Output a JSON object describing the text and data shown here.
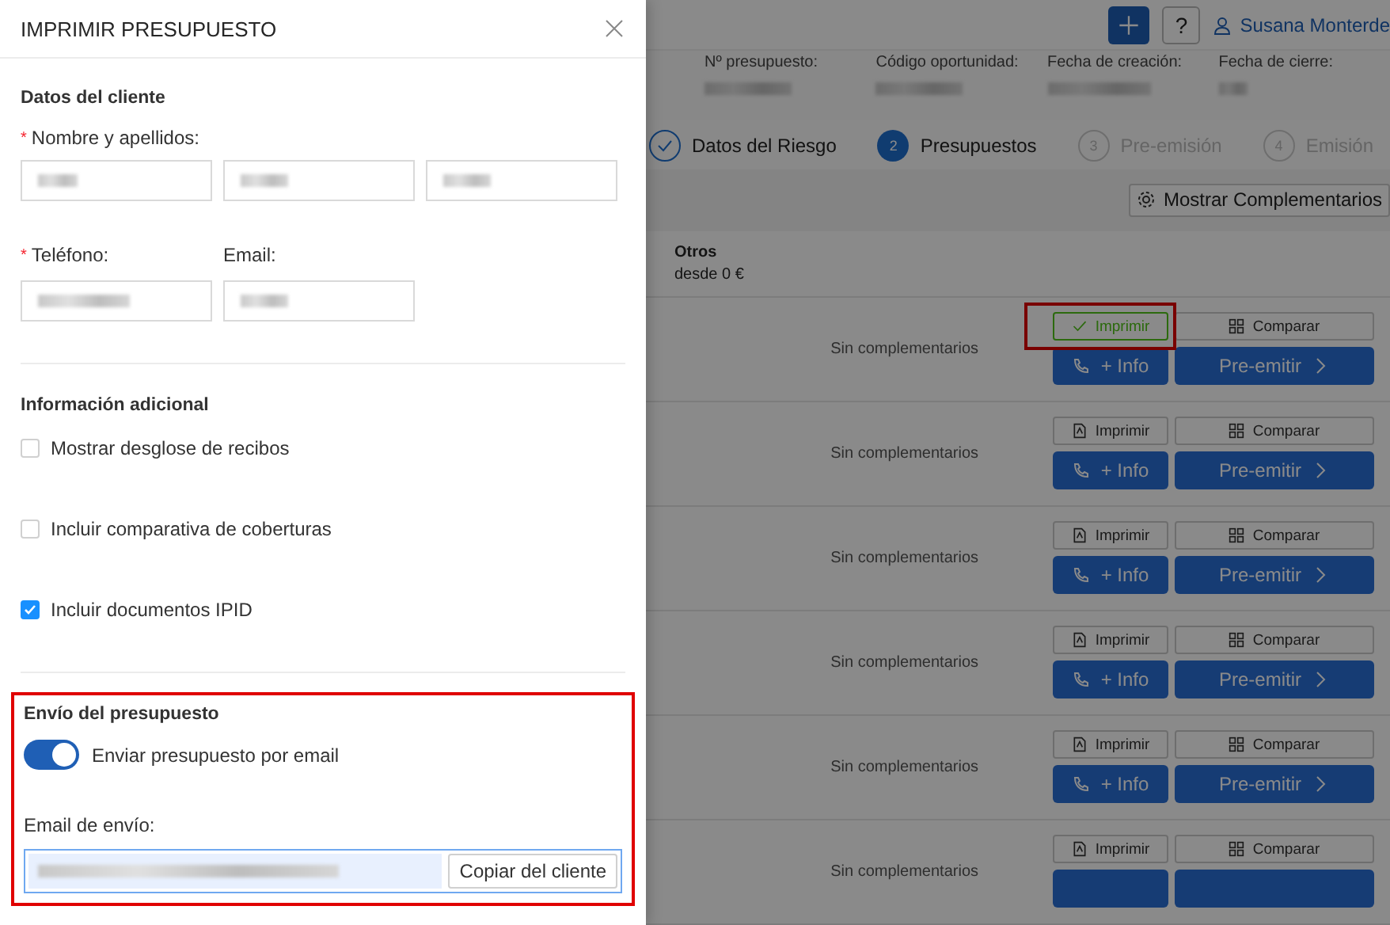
{
  "drawer": {
    "title": "IMPRIMIR PRESUPUESTO",
    "client_section": {
      "heading": "Datos del cliente",
      "name_label": "Nombre y apellidos:",
      "name_required_mark": "*",
      "phone_label": "Teléfono:",
      "phone_required_mark": "*",
      "email_label": "Email:"
    },
    "extra_section": {
      "heading": "Información adicional",
      "options": [
        {
          "label": "Mostrar desglose de recibos",
          "checked": false
        },
        {
          "label": "Incluir comparativa de coberturas",
          "checked": false
        },
        {
          "label": "Incluir documentos IPID",
          "checked": true
        }
      ]
    },
    "send_section": {
      "heading": "Envío del presupuesto",
      "highlighted": true,
      "toggle": {
        "label": "Enviar presupuesto por email",
        "on": true
      },
      "email_label": "Email de envío:",
      "copy_button": "Copiar del cliente"
    }
  },
  "page": {
    "help_button": "?",
    "user": "Susana Monterde",
    "summary": [
      "Nº presupuesto:",
      "Código oportunidad:",
      "Fecha de creación:",
      "Fecha de cierre:"
    ],
    "steps": [
      {
        "label": "Datos del Riesgo",
        "done": true,
        "current": false
      },
      {
        "number": "2",
        "label": "Presupuestos",
        "done": false,
        "current": true
      },
      {
        "number": "3",
        "label": "Pre-emisión",
        "done": false,
        "current": false
      },
      {
        "number": "4",
        "label": "Emisión",
        "done": false,
        "current": false
      }
    ],
    "complements_button": "Mostrar Complementarios",
    "group": {
      "name": "Otros",
      "price": "desde 0 €"
    },
    "rows": [
      {
        "note": "Sin complementarios",
        "print": "Imprimir",
        "printed": true,
        "highlighted": true,
        "compare": "Comparar",
        "info": "+ Info",
        "issue": "Pre-emitir"
      },
      {
        "note": "Sin complementarios",
        "print": "Imprimir",
        "printed": false,
        "highlighted": false,
        "compare": "Comparar",
        "info": "+ Info",
        "issue": "Pre-emitir"
      },
      {
        "note": "Sin complementarios",
        "print": "Imprimir",
        "printed": false,
        "highlighted": false,
        "compare": "Comparar",
        "info": "+ Info",
        "issue": "Pre-emitir"
      },
      {
        "note": "Sin complementarios",
        "print": "Imprimir",
        "printed": false,
        "highlighted": false,
        "compare": "Comparar",
        "info": "+ Info",
        "issue": "Pre-emitir"
      },
      {
        "note": "Sin complementarios",
        "print": "Imprimir",
        "printed": false,
        "highlighted": false,
        "compare": "Comparar",
        "info": "+ Info",
        "issue": "Pre-emitir"
      },
      {
        "note": "Sin complementarios",
        "print": "Imprimir",
        "printed": false,
        "highlighted": false,
        "compare": "Comparar"
      }
    ]
  }
}
